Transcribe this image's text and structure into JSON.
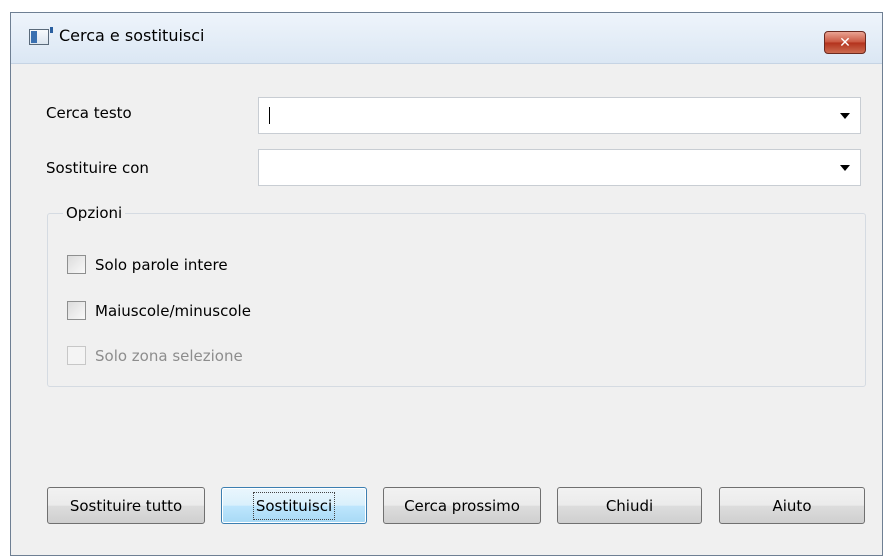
{
  "window": {
    "title": "Cerca e sostituisci",
    "close_glyph": "✕"
  },
  "fields": {
    "find_label": "Cerca testo",
    "find_value": "",
    "replace_label": "Sostituire con",
    "replace_value": ""
  },
  "options": {
    "group_label": "Opzioni",
    "items": [
      {
        "label": "Solo parole intere",
        "checked": false,
        "enabled": true
      },
      {
        "label": "Maiuscole/minuscole",
        "checked": false,
        "enabled": true
      },
      {
        "label": "Solo zona selezione",
        "checked": false,
        "enabled": false
      }
    ]
  },
  "buttons": {
    "replace_all": "Sostituire tutto",
    "replace": "Sostituisci",
    "find_next": "Cerca prossimo",
    "close": "Chiudi",
    "help": "Aiuto"
  },
  "icons": {
    "app": "window-icon",
    "close": "close-icon",
    "dropdown": "chevron-down-icon"
  }
}
